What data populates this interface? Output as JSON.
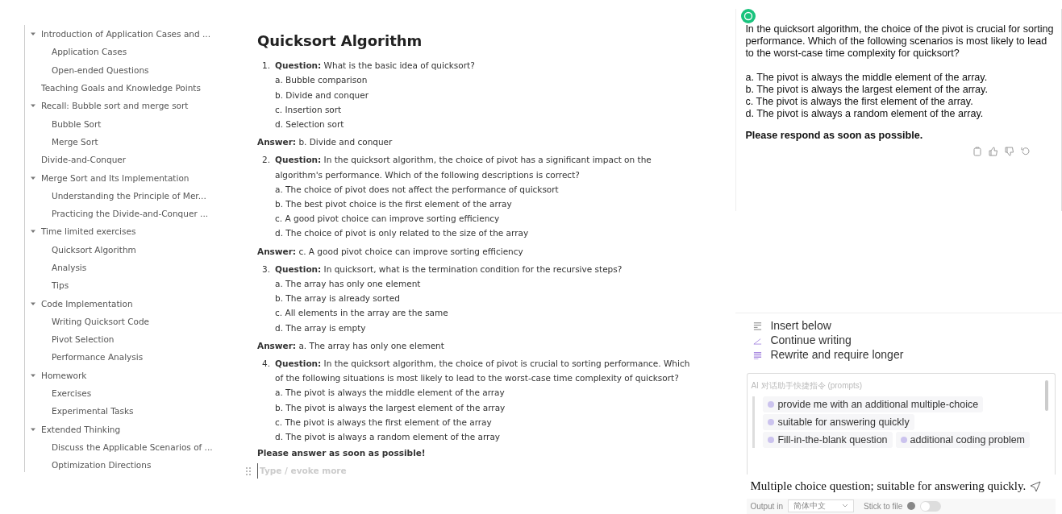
{
  "outline": [
    {
      "label": "Introduction of Application Cases and ...",
      "expanded": true,
      "children": [
        {
          "label": "Application Cases"
        },
        {
          "label": "Open-ended Questions"
        }
      ]
    },
    {
      "label": "Teaching Goals and Knowledge Points"
    },
    {
      "label": "Recall: Bubble sort and merge sort",
      "expanded": true,
      "children": [
        {
          "label": "Bubble Sort"
        },
        {
          "label": "Merge Sort"
        }
      ]
    },
    {
      "label": "Divide-and-Conquer"
    },
    {
      "label": "Merge Sort and Its Implementation",
      "expanded": true,
      "children": [
        {
          "label": "Understanding the Principle of Mer..."
        },
        {
          "label": "Practicing the Divide-and-Conquer ..."
        }
      ]
    },
    {
      "label": "Time limited exercises",
      "expanded": true,
      "children": [
        {
          "label": "Quicksort Algorithm"
        },
        {
          "label": "Analysis"
        },
        {
          "label": "Tips"
        }
      ]
    },
    {
      "label": "Code Implementation",
      "expanded": true,
      "children": [
        {
          "label": "Writing Quicksort Code"
        },
        {
          "label": "Pivot Selection"
        },
        {
          "label": "Performance Analysis"
        }
      ]
    },
    {
      "label": "Homework",
      "expanded": true,
      "children": [
        {
          "label": "Exercises"
        },
        {
          "label": "Experimental Tasks"
        }
      ]
    },
    {
      "label": "Extended Thinking",
      "expanded": true,
      "children": [
        {
          "label": "Discuss the Applicable Scenarios of ..."
        },
        {
          "label": "Optimization Directions"
        }
      ]
    }
  ],
  "document": {
    "title": "Quicksort Algorithm",
    "questions": [
      {
        "number": "1.",
        "question": "**Question:** What is the basic idea of quicksort?",
        "options": [
          "a. Bubble comparison",
          "b. Divide and conquer",
          "c. Insertion sort",
          "d. Selection sort"
        ],
        "answer": "**Answer:** b. Divide and conquer"
      },
      {
        "number": "2.",
        "question": "**Question:** In the quicksort algorithm, the choice of pivot has a significant impact on the algorithm's performance. Which of the following descriptions is correct?",
        "options": [
          "a. The choice of pivot does not affect the performance of quicksort",
          "b. The best pivot choice is the first element of the array",
          "c. A good pivot choice can improve sorting efficiency",
          "d. The choice of pivot is only related to the size of the array"
        ],
        "answer": "**Answer:** c. A good pivot choice can improve sorting efficiency"
      },
      {
        "number": "3.",
        "question": "**Question:** In quicksort, what is the termination condition for the recursive steps?",
        "options": [
          "a. The array has only one element",
          "b. The array is already sorted",
          "c. All elements in the array are the same",
          "d. The array is empty"
        ],
        "answer": "**Answer:** a. The array has only one element"
      },
      {
        "number": "4.",
        "question": "**Question:** In the quicksort algorithm, the choice of pivot is crucial to sorting performance. Which of the following situations is most likely to lead to the worst-case time complexity of quicksort?",
        "options": [
          "a. The pivot is always the middle element of the array",
          "b. The pivot is always the largest element of the array",
          "c. The pivot is always the first element of the array",
          "d. The pivot is always a random element of the array"
        ]
      }
    ],
    "closing": "Please answer as soon as possible!",
    "editor": {
      "placeholder": "Type / evoke more"
    }
  },
  "assistant": {
    "message": "In the quicksort algorithm, the choice of the pivot is crucial for sorting performance. Which of the following scenarios is most likely to lead to the worst-case time complexity for quicksort?",
    "options": [
      "a. The pivot is always the middle element of the array.",
      "b. The pivot is always the largest element of the array.",
      "c. The pivot is always the first element of the array.",
      "d. The pivot is always a random element of the array."
    ],
    "closing": "Please respond as soon as possible.",
    "actions": [
      {
        "kind": "copy"
      },
      {
        "kind": "like"
      },
      {
        "kind": "dislike"
      },
      {
        "kind": "retry"
      }
    ],
    "menu": [
      {
        "kind": "insert",
        "label": "Insert below"
      },
      {
        "kind": "continue",
        "label": "Continue writing"
      },
      {
        "kind": "rewrite",
        "label": "Rewrite and require longer"
      }
    ],
    "prompts": {
      "title": "AI 对话助手快捷指令 (prompts)",
      "chips": [
        "provide me with an additional multiple-choice",
        "suitable for answering quickly",
        "Fill-in-the-blank question",
        "additional coding problem"
      ]
    },
    "input": {
      "value": "Multiple choice question; suitable for answering quickly."
    },
    "output_label": "Output in",
    "language": "简体中文",
    "stick_label": "Stick to file",
    "stick_to_file": false
  }
}
